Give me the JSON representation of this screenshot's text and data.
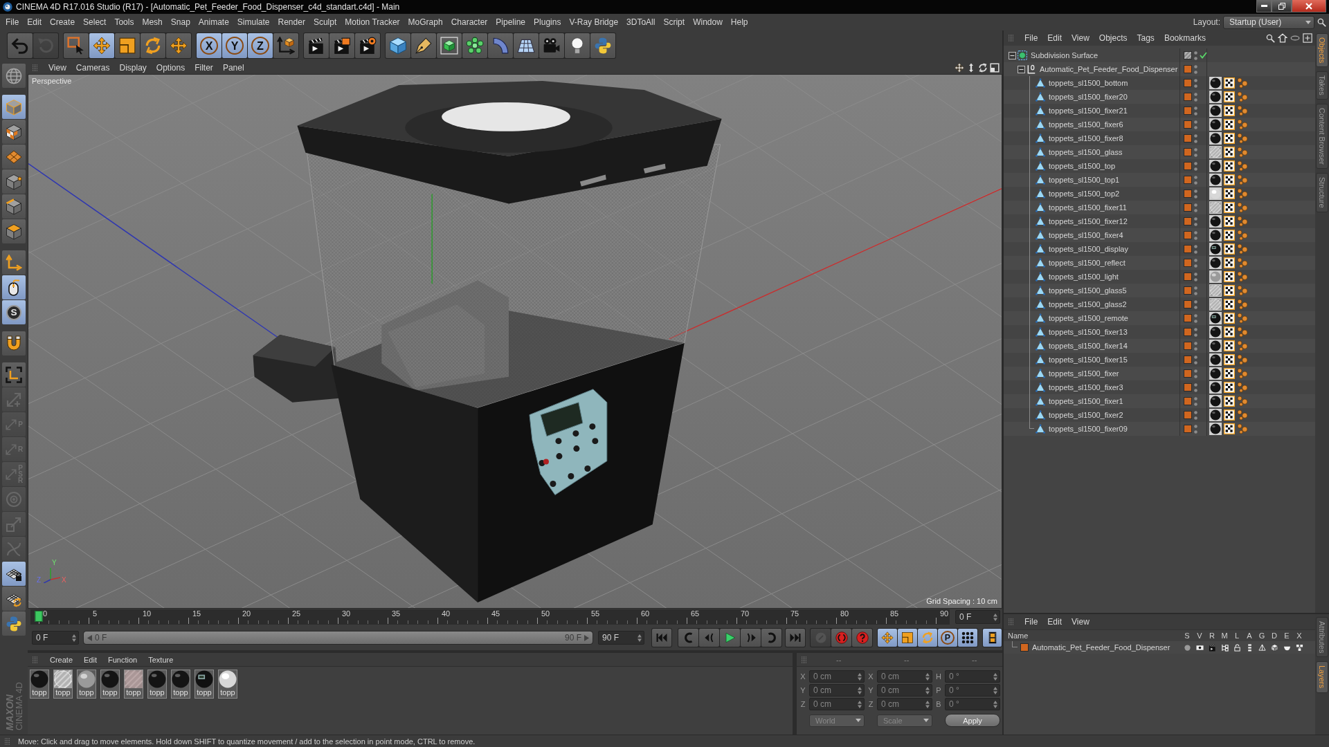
{
  "window": {
    "title": "CINEMA 4D R17.016 Studio (R17) - [Automatic_Pet_Feeder_Food_Dispenser_c4d_standart.c4d] - Main"
  },
  "menu_bar": {
    "items": [
      "File",
      "Edit",
      "Create",
      "Select",
      "Tools",
      "Mesh",
      "Snap",
      "Animate",
      "Simulate",
      "Render",
      "Sculpt",
      "Motion Tracker",
      "MoGraph",
      "Character",
      "Pipeline",
      "Plugins",
      "V-Ray Bridge",
      "3DToAll",
      "Script",
      "Window",
      "Help"
    ],
    "layout_label": "Layout:",
    "layout_value": "Startup (User)"
  },
  "toolbar": {
    "groups": [
      [
        {
          "active": false,
          "disabled": false
        },
        {
          "active": false,
          "disabled": true
        }
      ],
      [
        {
          "active": false
        },
        {
          "active": true
        },
        {
          "active": false
        },
        {
          "active": false
        },
        {
          "active": false
        }
      ],
      [
        {
          "label": "X",
          "active": true
        },
        {
          "label": "Y",
          "active": true
        },
        {
          "label": "Z",
          "active": true
        },
        {
          "active": false
        }
      ],
      [
        {
          "active": false
        },
        {
          "active": false
        },
        {
          "active": false
        }
      ],
      [
        {
          "active": false
        },
        {
          "active": false
        },
        {
          "active": false
        },
        {
          "active": false
        },
        {
          "active": false
        },
        {
          "active": false
        },
        {
          "active": false
        },
        {
          "active": false
        },
        {
          "active": false
        }
      ]
    ]
  },
  "tool_palette": {
    "groups": [
      [
        {
          "active": false,
          "disabled": false
        }
      ],
      [
        {
          "active": true,
          "disabled": false
        },
        {
          "active": false,
          "disabled": false
        },
        {
          "active": false,
          "disabled": false
        },
        {
          "active": false,
          "disabled": false
        },
        {
          "active": false,
          "disabled": false
        },
        {
          "active": false,
          "disabled": false
        }
      ],
      [
        {
          "active": false,
          "disabled": false
        },
        {
          "active": true,
          "disabled": false
        },
        {
          "label": "S",
          "active": true,
          "disabled": false
        }
      ],
      [
        {
          "active": false,
          "disabled": false
        }
      ],
      [
        {
          "active": false,
          "disabled": false
        },
        {
          "active": false,
          "disabled": true
        },
        {
          "label": "P",
          "active": false,
          "disabled": true
        },
        {
          "label": "R",
          "active": false,
          "disabled": true
        },
        {
          "label": "PSR",
          "active": false,
          "disabled": true
        },
        {
          "active": false,
          "disabled": true
        },
        {
          "active": false,
          "disabled": true
        },
        {
          "active": false,
          "disabled": true
        },
        {
          "active": true,
          "disabled": false
        },
        {
          "active": false,
          "disabled": false
        },
        {
          "active": false,
          "disabled": false
        }
      ]
    ]
  },
  "viewport": {
    "menu": [
      "View",
      "Cameras",
      "Display",
      "Options",
      "Filter",
      "Panel"
    ],
    "camera": "Perspective",
    "grid_spacing": "Grid Spacing : 10 cm",
    "gizmo_labels": [
      "Y",
      "Z",
      "X"
    ]
  },
  "timeline": {
    "ticks": [
      "0",
      "5",
      "10",
      "15",
      "20",
      "25",
      "30",
      "35",
      "40",
      "45",
      "50",
      "55",
      "60",
      "65",
      "70",
      "75",
      "80",
      "85",
      "90"
    ],
    "level": 0,
    "frame_field": "0 F"
  },
  "playback": {
    "start_field": "0 F",
    "range": {
      "start": "0 F",
      "end": "90 F",
      "level": 1
    },
    "end_field": "90 F",
    "record_buttons": [
      {
        "disabled": true
      },
      {
        "disabled": false
      },
      {
        "disabled": false
      }
    ],
    "key_modes": [
      {
        "active": true
      },
      {
        "active": true
      },
      {
        "active": true
      },
      {
        "label": "P",
        "active": true
      },
      {
        "active": true
      }
    ],
    "timeline_toggle": {
      "active": true
    }
  },
  "material_manager": {
    "menu": [
      "Create",
      "Edit",
      "Function",
      "Texture"
    ],
    "materials": [
      {
        "name": "topp",
        "kind": "dark"
      },
      {
        "name": "topp",
        "kind": "glass"
      },
      {
        "name": "topp",
        "kind": "gray"
      },
      {
        "name": "topp",
        "kind": "dark"
      },
      {
        "name": "topp",
        "kind": "tinted"
      },
      {
        "name": "topp",
        "kind": "dark"
      },
      {
        "name": "topp",
        "kind": "dark"
      },
      {
        "name": "topp",
        "kind": "screen"
      },
      {
        "name": "topp",
        "kind": "white"
      }
    ]
  },
  "coordinates": {
    "headers": [
      "--",
      "--",
      "--"
    ],
    "disabled": true,
    "rows": [
      {
        "position_axis": "X",
        "position": "0 cm",
        "size_axis": "X",
        "size": "0 cm",
        "rotation_axis": "H",
        "rotation": "0 °"
      },
      {
        "position_axis": "Y",
        "position": "0 cm",
        "size_axis": "Y",
        "size": "0 cm",
        "rotation_axis": "P",
        "rotation": "0 °"
      },
      {
        "position_axis": "Z",
        "position": "0 cm",
        "size_axis": "Z",
        "size": "0 cm",
        "rotation_axis": "B",
        "rotation": "0 °"
      }
    ],
    "space": "World",
    "mode": "Scale",
    "apply": "Apply"
  },
  "object_manager": {
    "menu": [
      "File",
      "Edit",
      "View",
      "Objects",
      "Tags",
      "Bookmarks"
    ],
    "tree": [
      {
        "name": "Subdivision Surface",
        "kind": "generator",
        "expanded": true,
        "enabled": true,
        "layer": false,
        "children": [
          {
            "name": "Automatic_Pet_Feeder_Food_Dispenser",
            "kind": "null",
            "expanded": true,
            "layer": true,
            "children": [
              {
                "name": "toppets_sl1500_bottom",
                "kind": "polygon",
                "layer": true,
                "material_tag": {
                  "kind": "dark"
                }
              },
              {
                "name": "toppets_sl1500_fixer20",
                "kind": "polygon",
                "layer": true,
                "material_tag": {
                  "kind": "dark"
                }
              },
              {
                "name": "toppets_sl1500_fixer21",
                "kind": "polygon",
                "layer": true,
                "material_tag": {
                  "kind": "dark"
                }
              },
              {
                "name": "toppets_sl1500_fixer6",
                "kind": "polygon",
                "layer": true,
                "material_tag": {
                  "kind": "dark"
                }
              },
              {
                "name": "toppets_sl1500_fixer8",
                "kind": "polygon",
                "layer": true,
                "material_tag": {
                  "kind": "dark"
                }
              },
              {
                "name": "toppets_sl1500_glass",
                "kind": "polygon",
                "layer": true,
                "material_tag": {
                  "kind": "glass"
                }
              },
              {
                "name": "toppets_sl1500_top",
                "kind": "polygon",
                "layer": true,
                "material_tag": {
                  "kind": "dark"
                }
              },
              {
                "name": "toppets_sl1500_top1",
                "kind": "polygon",
                "layer": true,
                "material_tag": {
                  "kind": "dark"
                }
              },
              {
                "name": "toppets_sl1500_top2",
                "kind": "polygon",
                "layer": true,
                "material_tag": {
                  "kind": "white"
                }
              },
              {
                "name": "toppets_sl1500_fixer11",
                "kind": "polygon",
                "layer": true,
                "material_tag": {
                  "kind": "glass"
                }
              },
              {
                "name": "toppets_sl1500_fixer12",
                "kind": "polygon",
                "layer": true,
                "material_tag": {
                  "kind": "dark"
                }
              },
              {
                "name": "toppets_sl1500_fixer4",
                "kind": "polygon",
                "layer": true,
                "material_tag": {
                  "kind": "dark"
                }
              },
              {
                "name": "toppets_sl1500_display",
                "kind": "polygon",
                "layer": true,
                "material_tag": {
                  "kind": "screen"
                }
              },
              {
                "name": "toppets_sl1500_reflect",
                "kind": "polygon",
                "layer": true,
                "material_tag": {
                  "kind": "dark"
                }
              },
              {
                "name": "toppets_sl1500_light",
                "kind": "polygon",
                "layer": true,
                "material_tag": {
                  "kind": "gray"
                }
              },
              {
                "name": "toppets_sl1500_glass5",
                "kind": "polygon",
                "layer": true,
                "material_tag": {
                  "kind": "glass"
                }
              },
              {
                "name": "toppets_sl1500_glass2",
                "kind": "polygon",
                "layer": true,
                "material_tag": {
                  "kind": "glass"
                }
              },
              {
                "name": "toppets_sl1500_remote",
                "kind": "polygon",
                "layer": true,
                "material_tag": {
                  "kind": "screen"
                }
              },
              {
                "name": "toppets_sl1500_fixer13",
                "kind": "polygon",
                "layer": true,
                "material_tag": {
                  "kind": "dark"
                }
              },
              {
                "name": "toppets_sl1500_fixer14",
                "kind": "polygon",
                "layer": true,
                "material_tag": {
                  "kind": "dark"
                }
              },
              {
                "name": "toppets_sl1500_fixer15",
                "kind": "polygon",
                "layer": true,
                "material_tag": {
                  "kind": "dark"
                }
              },
              {
                "name": "toppets_sl1500_fixer",
                "kind": "polygon",
                "layer": true,
                "material_tag": {
                  "kind": "dark"
                }
              },
              {
                "name": "toppets_sl1500_fixer3",
                "kind": "polygon",
                "layer": true,
                "material_tag": {
                  "kind": "dark"
                }
              },
              {
                "name": "toppets_sl1500_fixer1",
                "kind": "polygon",
                "layer": true,
                "material_tag": {
                  "kind": "dark"
                }
              },
              {
                "name": "toppets_sl1500_fixer2",
                "kind": "polygon",
                "layer": true,
                "material_tag": {
                  "kind": "dark"
                }
              },
              {
                "name": "toppets_sl1500_fixer09",
                "kind": "polygon",
                "layer": true,
                "material_tag": {
                  "kind": "dark"
                }
              }
            ]
          }
        ]
      }
    ]
  },
  "layer_manager": {
    "menu": [
      "File",
      "Edit",
      "View"
    ],
    "columns": [
      "Name",
      "S",
      "V",
      "R",
      "M",
      "L",
      "A",
      "G",
      "D",
      "E",
      "X"
    ],
    "layers": [
      {
        "name": "Automatic_Pet_Feeder_Food_Dispenser",
        "color": "#d0661f"
      }
    ]
  },
  "side_tabs": {
    "upper": [
      {
        "label": "Objects",
        "selected": true
      },
      {
        "label": "Takes",
        "selected": false
      },
      {
        "label": "Content Browser",
        "selected": false
      },
      {
        "label": "Structure",
        "selected": false
      }
    ],
    "lower": [
      {
        "label": "Attributes",
        "selected": false
      },
      {
        "label": "Layers",
        "selected": true
      }
    ]
  },
  "logo": {
    "brand": "MAXON",
    "product": "CINEMA 4D"
  },
  "status_bar": {
    "text": "Move: Click and drag to move elements. Hold down SHIFT to quantize movement / add to the selection in point mode, CTRL to remove."
  }
}
